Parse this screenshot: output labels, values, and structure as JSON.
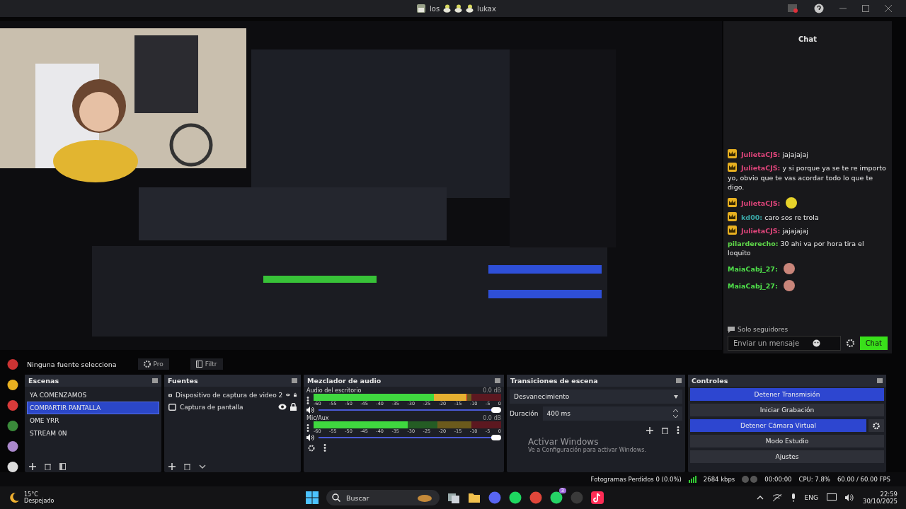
{
  "window": {
    "title_start": "los",
    "title_end": "lukax"
  },
  "chat": {
    "title": "Chat",
    "messages": [
      {
        "user": "JulietaCJS:",
        "color": "#e0457b",
        "badge": true,
        "kind": "text",
        "text": "jajajajaj"
      },
      {
        "user": "JulietaCJS:",
        "color": "#e0457b",
        "badge": true,
        "kind": "text",
        "text": "y si porque ya se te re importo yo, obvio que te vas acordar todo lo que te digo."
      },
      {
        "user": "JulietaCJS:",
        "color": "#e0457b",
        "badge": true,
        "kind": "emote"
      },
      {
        "user": "kd00:",
        "color": "#3aa6a6",
        "badge": true,
        "kind": "text",
        "text": "caro sos re trola"
      },
      {
        "user": "JulietaCJS:",
        "color": "#e0457b",
        "badge": true,
        "kind": "text",
        "text": "jajajajaj"
      },
      {
        "user": "pilarderecho:",
        "color": "#5fd84a",
        "badge": false,
        "kind": "text",
        "text": "30 ahi va por hora tira el loquito"
      },
      {
        "user": "MaiaCabj_27:",
        "color": "#4fe04a",
        "badge": false,
        "kind": "emote"
      },
      {
        "user": "MaiaCabj_27:",
        "color": "#4fe04a",
        "badge": false,
        "kind": "emote"
      }
    ],
    "mode": "Solo seguidores",
    "input": {
      "placeholder": "Enviar un mensaje"
    },
    "send": "Chat"
  },
  "source_bar": {
    "status": "Ninguna fuente selecciona",
    "properties": "Pro",
    "filters": "Filtr"
  },
  "scenes": {
    "title": "Escenas",
    "items": [
      {
        "label": "YA COMENZAMOS",
        "selected": false
      },
      {
        "label": "COMPARTIR PANTALLA",
        "selected": true
      },
      {
        "label": "OME YRR",
        "selected": false
      },
      {
        "label": "STREAM 0N",
        "selected": false
      }
    ]
  },
  "sources": {
    "title": "Fuentes",
    "items": [
      {
        "kind": "camera",
        "label": "Dispositivo de captura de video 2",
        "visible": true,
        "locked": true
      },
      {
        "kind": "display",
        "label": "Captura de pantalla",
        "visible": true,
        "locked": true
      }
    ]
  },
  "mixer": {
    "title": "Mezclador de audio",
    "channels": [
      {
        "name": "Audio del escritorio",
        "reading": "0.0 dB",
        "meter": {
          "level": 0.82
        },
        "fader": {
          "level": 1
        },
        "ticks": [
          "-60",
          "-55",
          "-50",
          "-45",
          "-40",
          "-35",
          "-30",
          "-25",
          "-20",
          "-15",
          "-10",
          "-5",
          "0"
        ]
      },
      {
        "name": "Mic/Aux",
        "reading": "0.0 dB",
        "meter": {
          "level": 0.5
        },
        "fader": {
          "level": 1
        },
        "ticks": [
          "-60",
          "-55",
          "-50",
          "-45",
          "-40",
          "-35",
          "-30",
          "-25",
          "-20",
          "-15",
          "-10",
          "-5",
          "0"
        ]
      }
    ]
  },
  "transitions": {
    "title": "Transiciones de escena",
    "transition": "Desvanecimiento",
    "duration_label": "Duración",
    "duration": "400 ms"
  },
  "controls": {
    "title": "Controles",
    "buttons": [
      {
        "label": "Detener Transmisión",
        "active": true,
        "settings": false
      },
      {
        "label": "Iniciar Grabación",
        "active": false,
        "settings": false
      },
      {
        "label": "Detener Cámara Virtual",
        "active": true,
        "settings": true
      },
      {
        "label": "Modo Estudio",
        "active": false,
        "settings": false
      },
      {
        "label": "Ajustes",
        "active": false,
        "settings": false
      }
    ]
  },
  "activation": {
    "title": "Activar Windows",
    "text": "Ve a Configuración para activar Windows."
  },
  "status_bar": {
    "dropped": "Fotogramas Perdidos 0 (0.0%)",
    "bitrate": "2684 kbps",
    "time": "00:00:00",
    "cpu": "CPU: 7.8%",
    "fps": "60.00 / 60.00 FPS"
  },
  "taskbar": {
    "weather": {
      "temp": "15°C",
      "condition": "Despejado"
    },
    "search": {
      "placeholder": "Buscar"
    },
    "apps": [
      {
        "kind": "taskview"
      },
      {
        "kind": "folder"
      },
      {
        "kind": "discord"
      },
      {
        "kind": "spotify"
      },
      {
        "kind": "chrome"
      },
      {
        "kind": "whatsapp",
        "badge": "3"
      },
      {
        "kind": "obs"
      },
      {
        "kind": "tiktok"
      }
    ],
    "language": "ENG",
    "time": "22:59",
    "date": "30/10/2025"
  }
}
